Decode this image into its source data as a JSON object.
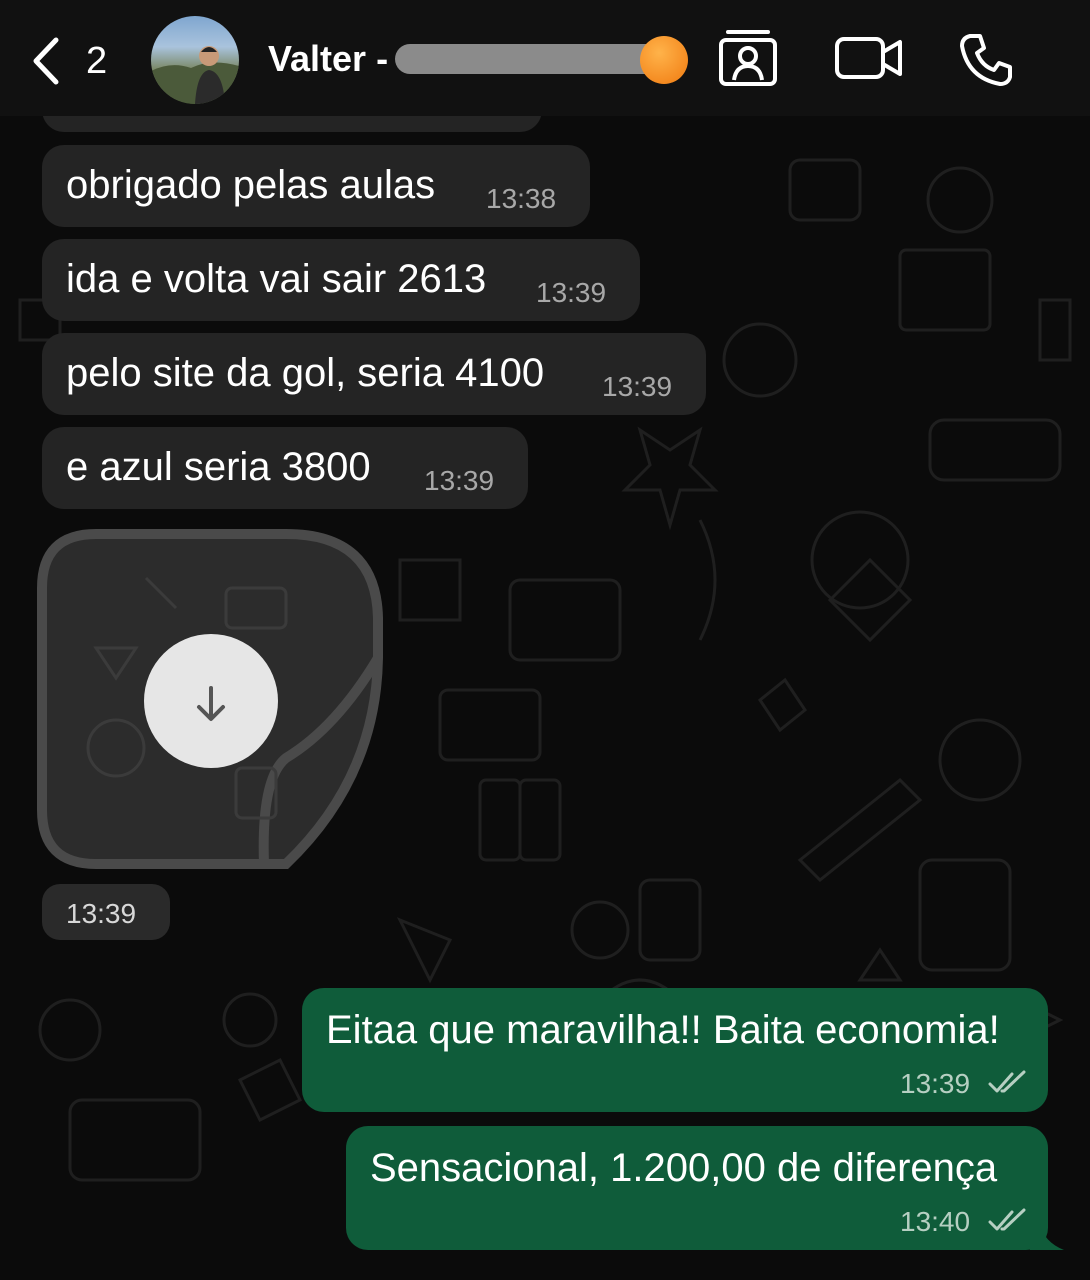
{
  "header": {
    "back_count": "2",
    "contact_name": "Valter -",
    "icons": [
      "back-chevron-icon",
      "contact-card-icon",
      "video-call-icon",
      "phone-call-icon"
    ]
  },
  "messages": [
    {
      "direction": "in",
      "text": "obrigado pelas aulas",
      "time": "13:38"
    },
    {
      "direction": "in",
      "text": "ida e volta vai sair 2613",
      "time": "13:39"
    },
    {
      "direction": "in",
      "text": "pelo site da gol, seria 4100",
      "time": "13:39"
    },
    {
      "direction": "in",
      "text": "e azul seria 3800",
      "time": "13:39"
    },
    {
      "direction": "in",
      "type": "sticker",
      "status": "not-downloaded",
      "time": "13:39"
    },
    {
      "direction": "out",
      "text": "Eitaa que maravilha!! Baita economia!",
      "time": "13:39",
      "status": "read"
    },
    {
      "direction": "out",
      "text": "Sensacional, 1.200,00 de diferença",
      "time": "13:40",
      "status": "read"
    }
  ],
  "colors": {
    "background": "#0b0b0b",
    "incoming_bubble": "#242424",
    "outgoing_bubble": "#0f5c3a",
    "header": "#111111"
  }
}
